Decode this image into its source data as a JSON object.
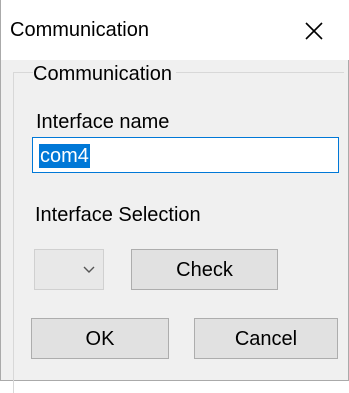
{
  "window": {
    "title": "Communication",
    "close_icon": "close-icon"
  },
  "group": {
    "legend": "Communication"
  },
  "interface_name": {
    "label": "Interface name",
    "value": "com4"
  },
  "interface_selection": {
    "label": "Interface Selection",
    "selected_value": "",
    "dropdown_icon": "chevron-down-icon",
    "check_label": "Check"
  },
  "buttons": {
    "ok_label": "OK",
    "cancel_label": "Cancel"
  },
  "colors": {
    "accent": "#0078d7",
    "dialog_bg": "#f0f0f0",
    "button_bg": "#e1e1e1"
  }
}
